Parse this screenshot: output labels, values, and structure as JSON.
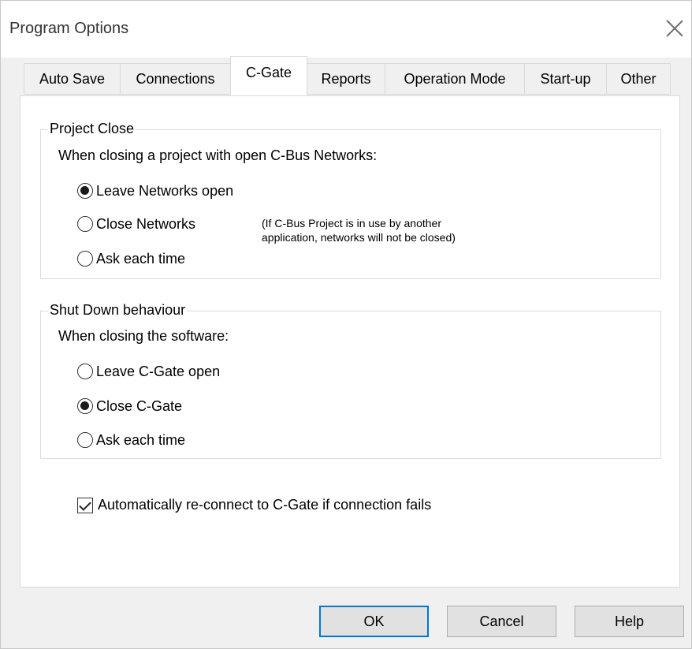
{
  "window": {
    "title": "Program Options"
  },
  "tabs": [
    {
      "label": "Auto Save"
    },
    {
      "label": "Connections"
    },
    {
      "label": "C-Gate",
      "active": true
    },
    {
      "label": "Reports"
    },
    {
      "label": "Operation Mode"
    },
    {
      "label": "Start-up"
    },
    {
      "label": "Other"
    }
  ],
  "project_close": {
    "label": "Project Close",
    "caption": "When closing a project with open C-Bus Networks:",
    "options": [
      {
        "label": "Leave Networks open",
        "selected": true
      },
      {
        "label": "Close Networks",
        "selected": false
      },
      {
        "label": "Ask each time",
        "selected": false
      }
    ],
    "note_line1": "(If C-Bus Project is in use by another",
    "note_line2": "application, networks will not be closed)"
  },
  "shutdown": {
    "label": "Shut Down behaviour",
    "caption": "When closing the software:",
    "options": [
      {
        "label": "Leave C-Gate open",
        "selected": false
      },
      {
        "label": "Close C-Gate",
        "selected": true
      },
      {
        "label": "Ask each time",
        "selected": false
      }
    ]
  },
  "reconnect": {
    "label": "Automatically re-connect to C-Gate if connection fails",
    "checked": true
  },
  "buttons": {
    "ok": "OK",
    "cancel": "Cancel",
    "help": "Help"
  }
}
